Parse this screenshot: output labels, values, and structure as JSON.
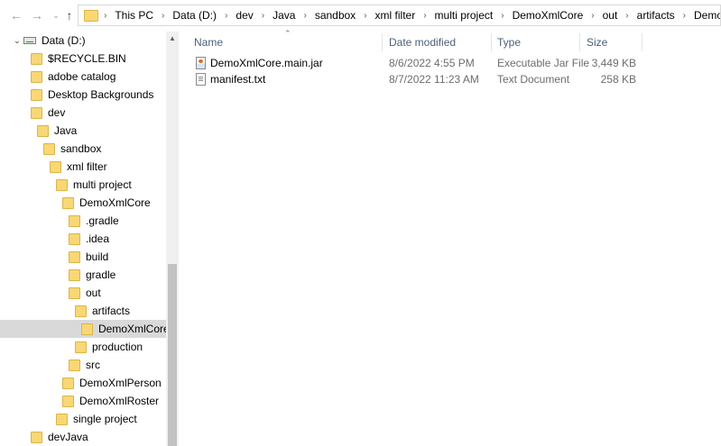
{
  "nav": {
    "back_icon": "back-arrow-icon",
    "forward_icon": "forward-arrow-icon",
    "recent_icon": "chevron-down-icon",
    "up_icon": "up-arrow-icon"
  },
  "breadcrumb": [
    "This PC",
    "Data (D:)",
    "dev",
    "Java",
    "sandbox",
    "xml filter",
    "multi project",
    "DemoXmlCore",
    "out",
    "artifacts",
    "DemoXmlCore_main_jar"
  ],
  "tree": [
    {
      "label": "Data (D:)",
      "kind": "drive",
      "level": 0,
      "expanded": true
    },
    {
      "label": "$RECYCLE.BIN",
      "kind": "folder",
      "level": 1
    },
    {
      "label": "adobe catalog",
      "kind": "folder",
      "level": 1
    },
    {
      "label": "Desktop Backgrounds",
      "kind": "folder",
      "level": 1
    },
    {
      "label": "dev",
      "kind": "folder",
      "level": 1
    },
    {
      "label": "Java",
      "kind": "folder",
      "level": 2
    },
    {
      "label": "sandbox",
      "kind": "folder",
      "level": 3
    },
    {
      "label": "xml filter",
      "kind": "folder",
      "level": 4
    },
    {
      "label": "multi project",
      "kind": "folder",
      "level": 5
    },
    {
      "label": "DemoXmlCore",
      "kind": "folder",
      "level": 6
    },
    {
      "label": ".gradle",
      "kind": "folder",
      "level": 7
    },
    {
      "label": ".idea",
      "kind": "folder",
      "level": 7
    },
    {
      "label": "build",
      "kind": "folder",
      "level": 7
    },
    {
      "label": "gradle",
      "kind": "folder",
      "level": 7
    },
    {
      "label": "out",
      "kind": "folder",
      "level": 7
    },
    {
      "label": "artifacts",
      "kind": "folder",
      "level": 8
    },
    {
      "label": "DemoXmlCore_main_jar",
      "kind": "folder",
      "level": 9,
      "selected": true
    },
    {
      "label": "production",
      "kind": "folder",
      "level": 8
    },
    {
      "label": "src",
      "kind": "folder",
      "level": 7
    },
    {
      "label": "DemoXmlPerson",
      "kind": "folder",
      "level": 6
    },
    {
      "label": "DemoXmlRoster",
      "kind": "folder",
      "level": 6
    },
    {
      "label": "single project",
      "kind": "folder",
      "level": 5
    },
    {
      "label": "devJava",
      "kind": "folder",
      "level": 1
    }
  ],
  "columns": {
    "name": "Name",
    "date": "Date modified",
    "type": "Type",
    "size": "Size"
  },
  "files": [
    {
      "name": "DemoXmlCore.main.jar",
      "date": "8/6/2022 4:55 PM",
      "type": "Executable Jar File",
      "size": "3,449 KB",
      "icon": "jar-file-icon"
    },
    {
      "name": "manifest.txt",
      "date": "8/7/2022 11:23 AM",
      "type": "Text Document",
      "size": "258 KB",
      "icon": "text-file-icon"
    }
  ]
}
